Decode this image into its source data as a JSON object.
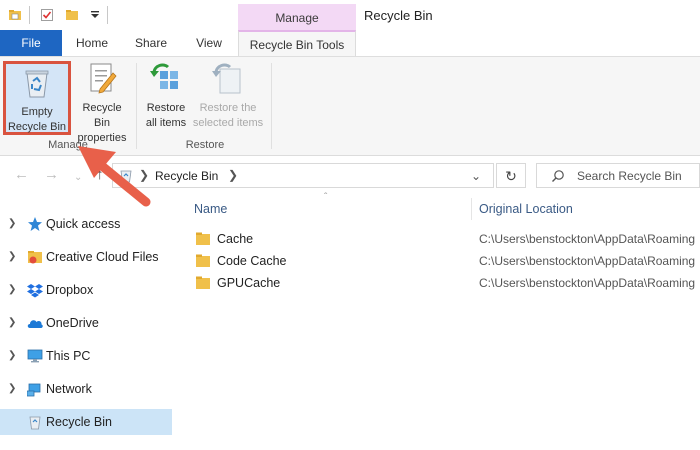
{
  "window": {
    "title": "Recycle Bin",
    "context_header": "Manage"
  },
  "tabs": [
    {
      "label": "File"
    },
    {
      "label": "Home"
    },
    {
      "label": "Share"
    },
    {
      "label": "View"
    },
    {
      "label": "Recycle Bin Tools"
    }
  ],
  "ribbon": {
    "buttons": [
      {
        "line1": "Empty",
        "line2": "Recycle Bin",
        "icon": "recycle-bin-icon"
      },
      {
        "line1": "Recycle Bin",
        "line2": "properties",
        "icon": "properties-icon"
      },
      {
        "line1": "Restore",
        "line2": "all items",
        "icon": "restore-all-icon"
      },
      {
        "line1": "Restore the",
        "line2": "selected items",
        "icon": "restore-selected-icon",
        "disabled": true
      }
    ],
    "groups": [
      {
        "label": "Manage"
      },
      {
        "label": "Restore"
      }
    ]
  },
  "address": {
    "location": "Recycle Bin"
  },
  "search": {
    "placeholder": "Search Recycle Bin"
  },
  "nav": {
    "items": [
      {
        "label": "Quick access",
        "icon": "star-icon"
      },
      {
        "label": "Creative Cloud Files",
        "icon": "creative-cloud-icon"
      },
      {
        "label": "Dropbox",
        "icon": "dropbox-icon"
      },
      {
        "label": "OneDrive",
        "icon": "onedrive-icon"
      },
      {
        "label": "This PC",
        "icon": "computer-icon"
      },
      {
        "label": "Network",
        "icon": "network-icon"
      },
      {
        "label": "Recycle Bin",
        "icon": "recycle-bin-icon",
        "selected": true
      }
    ]
  },
  "files": {
    "columns": {
      "name": "Name",
      "original_location": "Original Location"
    },
    "rows": [
      {
        "name": "Cache",
        "original_location": "C:\\Users\\benstockton\\AppData\\Roaming"
      },
      {
        "name": "Code Cache",
        "original_location": "C:\\Users\\benstockton\\AppData\\Roaming"
      },
      {
        "name": "GPUCache",
        "original_location": "C:\\Users\\benstockton\\AppData\\Roaming"
      }
    ]
  },
  "colors": {
    "file_tab": "#1e66c2",
    "context_tab": "#f3d9f5",
    "highlight_border": "#d9533f",
    "callout_arrow": "#e8604a",
    "nav_selected": "#cce4f7"
  }
}
